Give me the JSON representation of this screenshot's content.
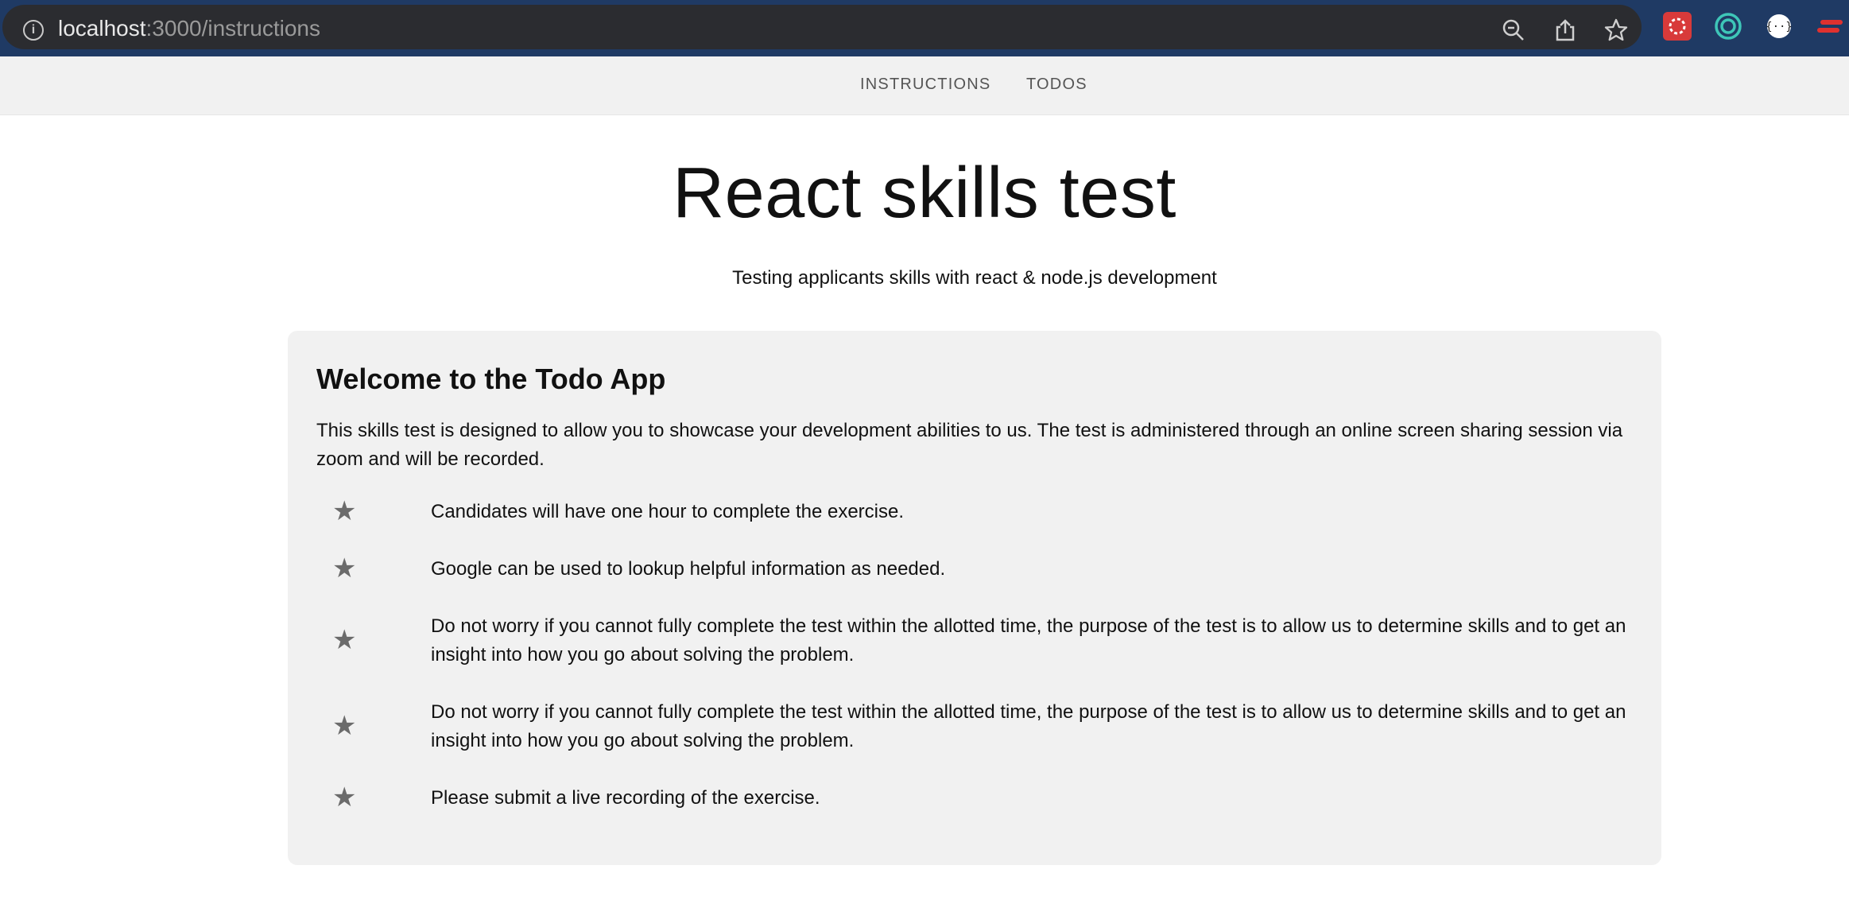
{
  "browser": {
    "url_host": "localhost",
    "url_path": ":3000/instructions"
  },
  "nav": {
    "items": [
      {
        "label": "INSTRUCTIONS"
      },
      {
        "label": "TODOS"
      }
    ]
  },
  "header": {
    "title": "React skills test",
    "subtitle": "Testing applicants skills with react & node.js development"
  },
  "card": {
    "title": "Welcome to the Todo App",
    "intro": "This skills test is designed to allow you to showcase your development abilities to us. The test is administered through an online screen sharing session via zoom and will be recorded.",
    "bullets": [
      {
        "text": "Candidates will have one hour to complete the exercise."
      },
      {
        "text": "Google can be used to lookup helpful information as needed."
      },
      {
        "text": "Do not worry if you cannot fully complete the test within the allotted time, the purpose of the test is to allow us to determine skills and to get an insight into how you go about solving the problem."
      },
      {
        "text": "Do not worry if you cannot fully complete the test within the allotted time, the purpose of the test is to allow us to determine skills and to get an insight into how you go about solving the problem."
      },
      {
        "text": "Please submit a live recording of the exercise."
      }
    ]
  },
  "colors": {
    "browser_frame": "#1f3a64",
    "url_bar": "#2b2c30",
    "navbar_bg": "#f1f1f1",
    "card_bg": "#f1f1f1",
    "star": "#6b6b6b"
  },
  "icons": [
    "info-icon",
    "zoom-out-icon",
    "share-icon",
    "bookmark-star-icon",
    "extension-icon",
    "star-icon"
  ]
}
